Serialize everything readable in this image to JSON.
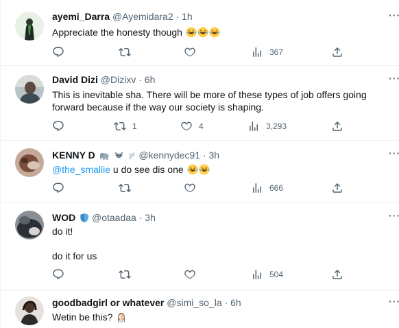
{
  "tweets": [
    {
      "name": "ayemi_Darra",
      "handle": "@Ayemidara2",
      "time": "1h",
      "text": "Appreciate the honesty though",
      "emojis": "😂😂😂",
      "replies": "",
      "retweets": "",
      "likes": "",
      "views": "367"
    },
    {
      "name": "David Dizi",
      "handle": "@Dizixv",
      "time": "6h",
      "text_line1": "This is inevitable sha. There will be more of these types of job offers going",
      "text_line2": "forward because if the way our society is shaping.",
      "replies": "",
      "retweets": "1",
      "likes": "4",
      "views": "3,293"
    },
    {
      "name": "KENNY D",
      "handle": "@kennydec91",
      "time": "3h",
      "mention": "@the_smallie",
      "text": " u do see dis one",
      "replies": "",
      "retweets": "",
      "likes": "",
      "views": "666"
    },
    {
      "name": "WOD",
      "handle": "@otaadaa",
      "time": "3h",
      "text_line1": "do it!",
      "text_line2": "do it for us",
      "replies": "",
      "retweets": "",
      "likes": "",
      "views": "504"
    },
    {
      "name": "goodbadgirl or whatever",
      "handle": "@simi_so_la",
      "time": "6h",
      "text": "Wetin be this?"
    }
  ],
  "ui": {
    "separator": "·",
    "more": "···"
  },
  "colors": {
    "accent": "#1d9bf0",
    "muted": "#536471",
    "text": "#0f1419"
  }
}
